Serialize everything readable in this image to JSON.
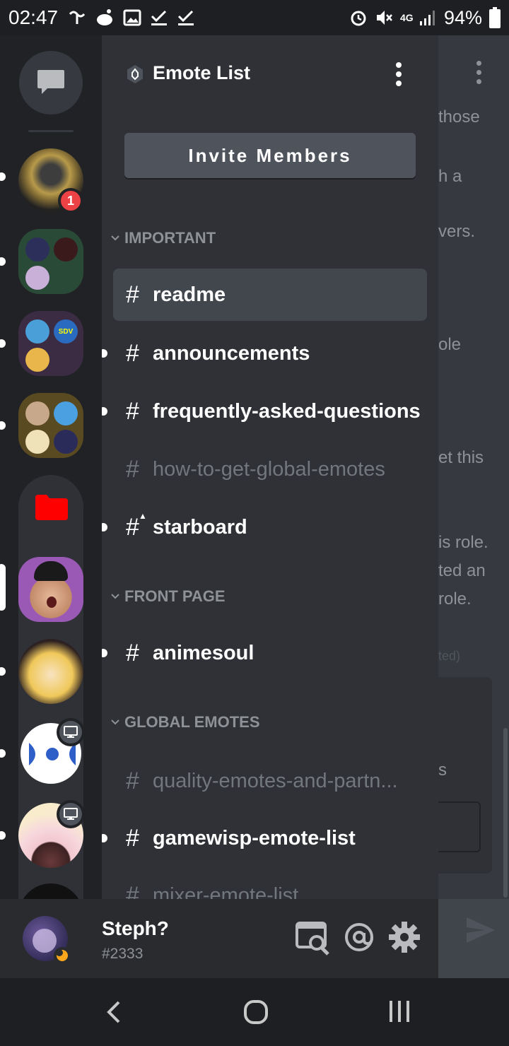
{
  "status_bar": {
    "time": "02:47",
    "network": "4G",
    "battery": "94%"
  },
  "server": {
    "name": "Emote List",
    "invite_label": "Invite Members"
  },
  "guilds": [
    {
      "name": "ring-server",
      "badge": "1"
    },
    {
      "name": "folder-1"
    },
    {
      "name": "folder-2",
      "label": "SDV"
    },
    {
      "name": "folder-3"
    },
    {
      "name": "red-folder"
    },
    {
      "name": "pogchamp-server"
    },
    {
      "name": "anime-server"
    },
    {
      "name": "blue-bow-server"
    },
    {
      "name": "maid-server"
    }
  ],
  "categories": [
    {
      "label": "IMPORTANT"
    },
    {
      "label": "FRONT PAGE"
    },
    {
      "label": "GLOBAL EMOTES"
    }
  ],
  "channels": {
    "readme": "readme",
    "announcements": "announcements",
    "faq": "frequently-asked-questions",
    "global": "how-to-get-global-emotes",
    "starboard": "starboard",
    "animesoul": "animesoul",
    "quality": "quality-emotes-and-partn...",
    "gamewisp": "gamewisp-emote-list",
    "mixer": "mixer-emote-list"
  },
  "background_chat": {
    "lines": [
      "those",
      "h a",
      "vers.",
      "ole",
      "et this",
      "is role.",
      "ted an",
      "role.",
      "ted)",
      "s"
    ]
  },
  "user": {
    "name": "Steph?",
    "tag": "#2333"
  },
  "colors": {
    "accent_badge": "#ed4245",
    "panel": "#2f3136",
    "rail": "#202225",
    "selected": "#42464d"
  },
  "icons": [
    "chat-bubble-icon",
    "boost-icon",
    "kebab-icon",
    "chevron-down-icon",
    "hash-icon",
    "rules-hash-icon",
    "stream-icon",
    "discover-search-icon",
    "at-mention-icon",
    "settings-gear-icon",
    "send-icon",
    "back-icon",
    "home-icon",
    "recents-icon"
  ]
}
